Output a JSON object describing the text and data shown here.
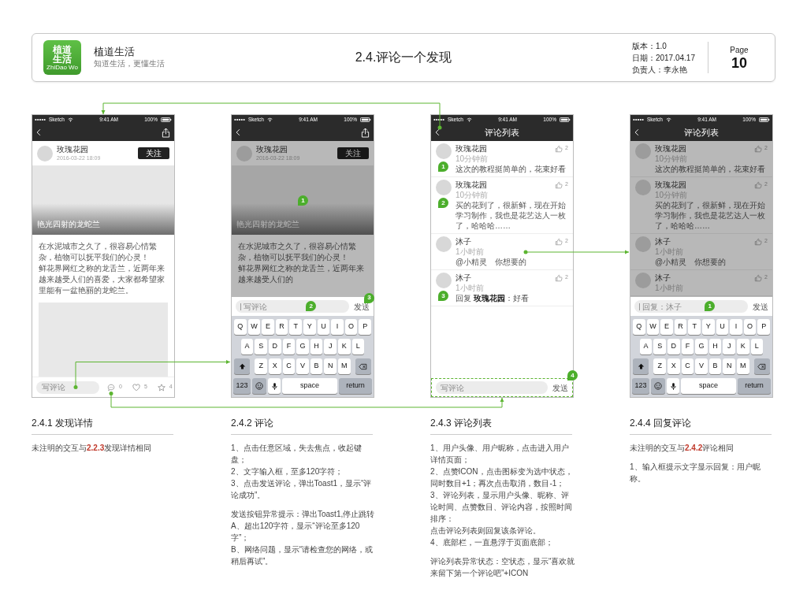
{
  "header": {
    "logo": {
      "line1": "植道",
      "line2": "生活",
      "caption": "ZhiDao Wo"
    },
    "app_name": "植道生活",
    "slogan": "知道生活，更懂生活",
    "page_title": "2.4.评论一个发现",
    "meta": [
      "版本：1.0",
      "日期：2017.04.17",
      "负责人：李永艳"
    ],
    "page_label": "Page",
    "page_number": "10"
  },
  "screens": [
    {
      "kind": "detail",
      "dimmed": false,
      "status": {
        "carrier": "Sketch",
        "time": "9:41 AM",
        "battery": "100%"
      },
      "nav": {
        "share": true
      },
      "author": {
        "name": "玫瑰花园",
        "date": "2016-03-22 18:09",
        "follow": "关注"
      },
      "cover": {
        "title": "艳光四射的龙蛇兰"
      },
      "paragraphs": [
        "在水泥城市之久了，很容易心情繁杂，植物可以抚平我们的心灵！",
        "鲜花界网红之称的龙舌兰，近两年来越来越受人们的喜爱，大家都希望家里能有一盆艳丽的龙蛇兰。"
      ],
      "bottom": {
        "placeholder": "写评论",
        "comments": "0",
        "likes": "5",
        "stars": "4"
      }
    },
    {
      "kind": "compose",
      "dimmed": true,
      "status": {
        "carrier": "Sketch",
        "time": "9:41 AM",
        "battery": "100%"
      },
      "nav": {
        "share": true
      },
      "author": {
        "name": "玫瑰花园",
        "date": "2016-03-22 18:09",
        "follow": "关注"
      },
      "cover": {
        "title": "艳光四射的龙蛇兰",
        "marker": "1"
      },
      "paragraphs": [
        "在水泥城市之久了，很容易心情繁杂，植物可以抚平我们的心灵！",
        "鲜花界网红之称的龙舌兰，近两年来越来越受人们的"
      ],
      "input": {
        "placeholder": "写评论",
        "focused": true,
        "marker": "2"
      },
      "send": {
        "label": "发送",
        "marker": "3"
      },
      "keyboard": {
        "rows": [
          [
            "Q",
            "W",
            "E",
            "R",
            "T",
            "Y",
            "U",
            "I",
            "O",
            "P"
          ],
          [
            "A",
            "S",
            "D",
            "F",
            "G",
            "H",
            "J",
            "K",
            "L"
          ],
          [
            "Z",
            "X",
            "C",
            "V",
            "B",
            "N",
            "M"
          ]
        ],
        "numbers": "123",
        "space": "space",
        "return": "return"
      }
    },
    {
      "kind": "comments",
      "dimmed": false,
      "status": {
        "carrier": "Sketch",
        "time": "9:41 AM",
        "battery": "100%"
      },
      "nav": {
        "title": "评论列表"
      },
      "comments": [
        {
          "name": "玫瑰花园",
          "time": "10分钟前",
          "text": "这次的教程挺简单的，花束好看",
          "likes": "2",
          "marker": "1"
        },
        {
          "name": "玫瑰花园",
          "time": "10分钟前",
          "text": "买的花到了，很新鲜，现在开始学习制作，我也是花艺达人一枚了，哈哈哈……",
          "likes": "2",
          "marker": "2"
        },
        {
          "name": "沐子",
          "time": "1小时前",
          "text": "@小精灵　你想要的",
          "likes": "2"
        },
        {
          "name": "沐子",
          "time": "1小时前",
          "text": "回复 **玫瑰花园**：好看",
          "likes": "2",
          "marker": "3"
        }
      ],
      "input": {
        "placeholder": "写评论",
        "focused": false
      },
      "send": {
        "label": "发送"
      },
      "bar_marker": "4"
    },
    {
      "kind": "reply",
      "dimmed": true,
      "status": {
        "carrier": "Sketch",
        "time": "9:41 AM",
        "battery": "100%"
      },
      "nav": {
        "title": "评论列表"
      },
      "comments": [
        {
          "name": "玫瑰花园",
          "time": "10分钟前",
          "text": "这次的教程挺简单的，花束好看",
          "likes": "2"
        },
        {
          "name": "玫瑰花园",
          "time": "10分钟前",
          "text": "买的花到了，很新鲜，现在开始学习制作，我也是花艺达人一枚了，哈哈哈……",
          "likes": "2"
        },
        {
          "name": "沐子",
          "time": "1小时前",
          "text": "@小精灵　你想要的",
          "likes": "2"
        },
        {
          "name": "沐子",
          "time": "1小时前",
          "likes": "2"
        }
      ],
      "input": {
        "placeholder": "回复：沐子",
        "focused": true,
        "marker": "1"
      },
      "send": {
        "label": "发送"
      },
      "keyboard": {
        "rows": [
          [
            "Q",
            "W",
            "E",
            "R",
            "T",
            "Y",
            "U",
            "I",
            "O",
            "P"
          ],
          [
            "A",
            "S",
            "D",
            "F",
            "G",
            "H",
            "J",
            "K",
            "L"
          ],
          [
            "Z",
            "X",
            "C",
            "V",
            "B",
            "N",
            "M"
          ]
        ],
        "numbers": "123",
        "space": "space",
        "return": "return"
      }
    }
  ],
  "sections": [
    {
      "title": "2.4.1 发现详情",
      "blocks": [
        [
          "未注明的交互与**2.2.3**发现详情相同"
        ]
      ]
    },
    {
      "title": "2.4.2 评论",
      "blocks": [
        [
          "1、点击任意区域，失去焦点，收起键盘；",
          "2、文字输入框，至多120字符；",
          "3、点击发送评论，弹出Toast1，显示“评论成功”。"
        ],
        [
          "发送按钮异常提示：弹出Toast1,停止跳转",
          "A、超出120字符，显示“评论至多120字”；",
          "B、网络问题，显示“请检查您的网络，或稍后再试”。"
        ]
      ]
    },
    {
      "title": "2.4.3 评论列表",
      "blocks": [
        [
          "1、用户头像、用户昵称，点击进入用户详情页面；",
          "2、点赞ICON，点击图标变为选中状态，同时数目+1；再次点击取消，数目-1；",
          "3、评论列表，显示用户头像、昵称、评论时间、点赞数目、评论内容，按照时间排序：",
          "点击评论列表则回复该条评论。",
          "4、底部栏，一直悬浮于页面底部；"
        ],
        [
          "评论列表异常状态：空状态，显示“喜欢就来留下第一个评论吧”+ICON"
        ]
      ]
    },
    {
      "title": "2.4.4 回复评论",
      "blocks": [
        [
          "未注明的交互与**2.4.2**评论相同"
        ],
        [
          "1、输入框提示文字显示回复：用户昵称。"
        ]
      ]
    }
  ]
}
